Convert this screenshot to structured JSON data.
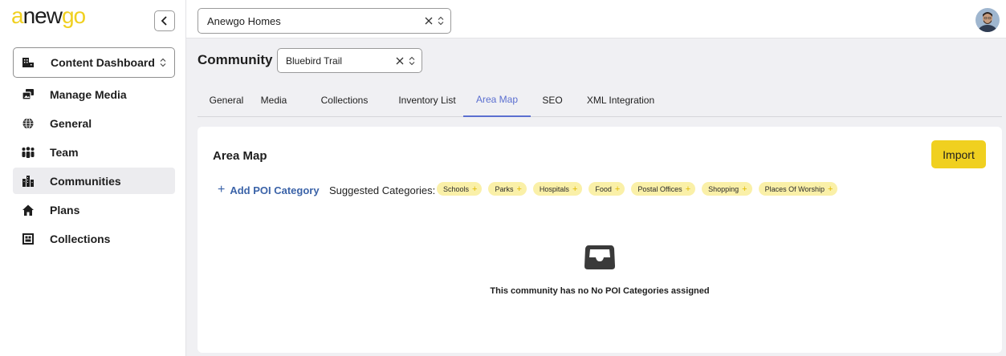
{
  "brand": {
    "logo_text": "anewgo",
    "accent_color": "#f0d020",
    "link_color": "#3b63a8",
    "active_tab_color": "#5b6fd0"
  },
  "sidebar": {
    "collapse_icon": "chevron-left-icon",
    "dashboard_select": {
      "icon": "building-icon",
      "value": "Content Dashboard"
    },
    "items": [
      {
        "label": "Manage Media",
        "icon": "media-icon",
        "active": false
      },
      {
        "label": "General",
        "icon": "globe-icon",
        "active": false
      },
      {
        "label": "Team",
        "icon": "team-icon",
        "active": false
      },
      {
        "label": "Communities",
        "icon": "city-icon",
        "active": true
      },
      {
        "label": "Plans",
        "icon": "home-icon",
        "active": false
      },
      {
        "label": "Collections",
        "icon": "collection-icon",
        "active": false
      }
    ]
  },
  "topbar": {
    "company_select": {
      "value": "Anewgo Homes"
    }
  },
  "community": {
    "label": "Community",
    "select_value": "Bluebird Trail"
  },
  "tabs": [
    {
      "label": "General",
      "active": false
    },
    {
      "label": "Media",
      "active": false
    },
    {
      "label": "Collections",
      "active": false
    },
    {
      "label": "Inventory List",
      "active": false
    },
    {
      "label": "Area Map",
      "active": true
    },
    {
      "label": "SEO",
      "active": false
    },
    {
      "label": "XML Integration",
      "active": false
    }
  ],
  "area_map": {
    "title": "Area Map",
    "import_label": "Import",
    "add_poi_label": "Add POI Category",
    "suggested_label": "Suggested Categories:",
    "suggested_categories": [
      "Schools",
      "Parks",
      "Hospitals",
      "Food",
      "Postal Offices",
      "Shopping",
      "Places Of Worship"
    ],
    "empty_message": "This community has no No POI Categories assigned"
  }
}
